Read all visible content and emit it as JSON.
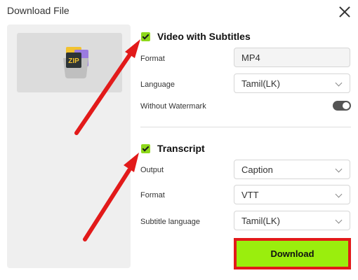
{
  "dialog": {
    "title": "Download File"
  },
  "preview": {
    "icon_label": "ZIP",
    "icon": "zip-file-icon"
  },
  "video_section": {
    "title": "Video with Subtitles",
    "checked": true,
    "format_label": "Format",
    "format_value": "MP4",
    "language_label": "Language",
    "language_value": "Tamil(LK)",
    "watermark_label": "Without Watermark",
    "watermark_on": true
  },
  "transcript_section": {
    "title": "Transcript",
    "checked": true,
    "output_label": "Output",
    "output_value": "Caption",
    "format_label": "Format",
    "format_value": "VTT",
    "subtitle_language_label": "Subtitle language",
    "subtitle_language_value": "Tamil(LK)"
  },
  "actions": {
    "download_label": "Download"
  },
  "colors": {
    "accent_green": "#9aee0d",
    "checkbox_green": "#8ed81b",
    "annotation_red": "#e21a1a"
  }
}
